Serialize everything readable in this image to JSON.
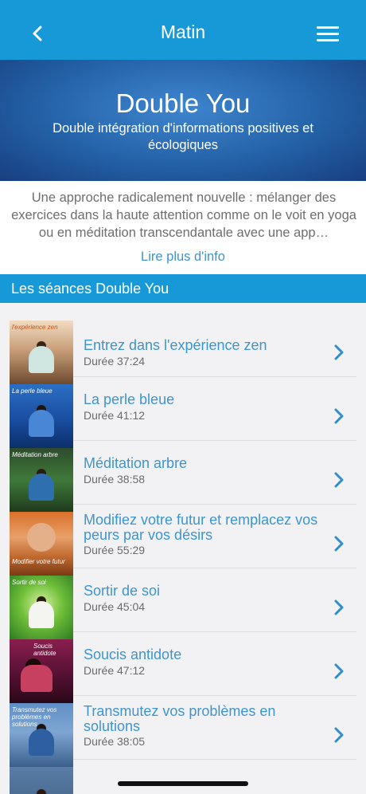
{
  "header": {
    "title": "Matin",
    "back_icon": "chevron-left-icon",
    "menu_icon": "hamburger-menu-icon"
  },
  "hero": {
    "title": "Double You",
    "subtitle": "Double intégration d'informations positives et écologiques"
  },
  "description": {
    "text": "Une approche radicalement nouvelle : mélanger des exercices dans la haute attention comme on le voit en yoga ou en méditation transcendantale avec une app…",
    "more_link": "Lire plus d'info"
  },
  "section": {
    "title": "Les séances Double You"
  },
  "sessions": [
    {
      "title": "Entrez dans l'expérience zen",
      "duration": "Durée 37:24",
      "thumb_label": "l'expérience zen"
    },
    {
      "title": "La perle bleue",
      "duration": "Durée 41:12",
      "thumb_label": "La perle bleue"
    },
    {
      "title": "Méditation arbre",
      "duration": "Durée 38:58",
      "thumb_label": "Méditation arbre"
    },
    {
      "title": "Modifiez votre futur et remplacez vos peurs par vos désirs",
      "duration": "Durée 55:29",
      "thumb_label": "Modifier votre futur"
    },
    {
      "title": "Sortir de soi",
      "duration": "Durée 45:04",
      "thumb_label": "Sortir de soi"
    },
    {
      "title": "Soucis antidote",
      "duration": "Durée 47:12",
      "thumb_label": "Soucis antidote"
    },
    {
      "title": "Transmutez vos problèmes en solutions",
      "duration": "Durée 38:05",
      "thumb_label": "Transmutez vos problèmes en solutions"
    }
  ],
  "colors": {
    "header_blue": "#1799d8",
    "link_blue": "#3d95cf"
  }
}
